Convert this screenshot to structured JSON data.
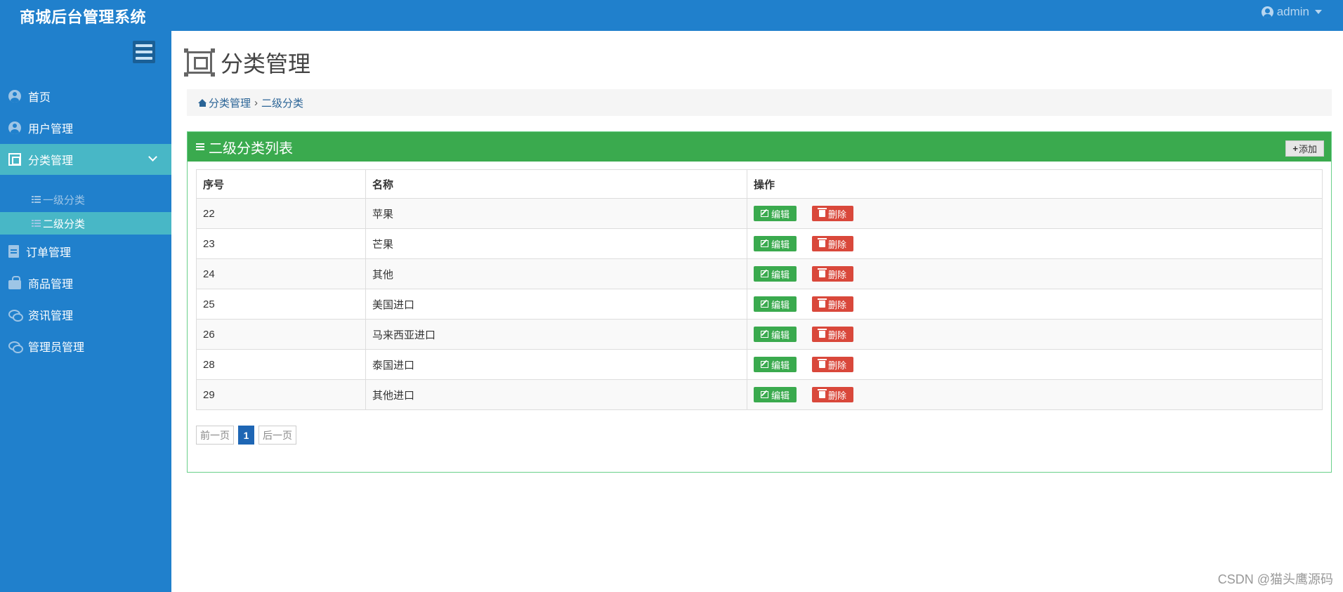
{
  "app": {
    "title": "商城后台管理系统",
    "user": "admin"
  },
  "sidebar": {
    "items": [
      {
        "label": "首页",
        "icon": "user-circle-icon"
      },
      {
        "label": "用户管理",
        "icon": "user-circle-icon"
      },
      {
        "label": "分类管理",
        "icon": "category-icon",
        "active": true,
        "expanded": true,
        "children": [
          {
            "label": "一级分类"
          },
          {
            "label": "二级分类",
            "active": true
          }
        ]
      },
      {
        "label": "订单管理",
        "icon": "document-icon"
      },
      {
        "label": "商品管理",
        "icon": "shopping-bag-icon"
      },
      {
        "label": "资讯管理",
        "icon": "chat-icon"
      },
      {
        "label": "管理员管理",
        "icon": "chat-icon"
      }
    ]
  },
  "page": {
    "title": "分类管理"
  },
  "breadcrumb": {
    "parent": "分类管理",
    "current": "二级分类"
  },
  "panel": {
    "title": "二级分类列表",
    "add_label": "添加"
  },
  "table": {
    "headers": [
      "序号",
      "名称",
      "操作"
    ],
    "edit_label": "编辑",
    "delete_label": "删除",
    "rows": [
      {
        "id": "22",
        "name": "苹果"
      },
      {
        "id": "23",
        "name": "芒果"
      },
      {
        "id": "24",
        "name": "其他"
      },
      {
        "id": "25",
        "name": "美国进口"
      },
      {
        "id": "26",
        "name": "马来西亚进口"
      },
      {
        "id": "28",
        "name": "泰国进口"
      },
      {
        "id": "29",
        "name": "其他进口"
      }
    ]
  },
  "pagination": {
    "prev": "前一页",
    "current": "1",
    "next": "后一页"
  },
  "watermark": "CSDN @猫头鹰源码",
  "colors": {
    "primary": "#2080cc",
    "active": "#48b7c6",
    "success": "#3aaa4e",
    "danger": "#d9483b"
  }
}
